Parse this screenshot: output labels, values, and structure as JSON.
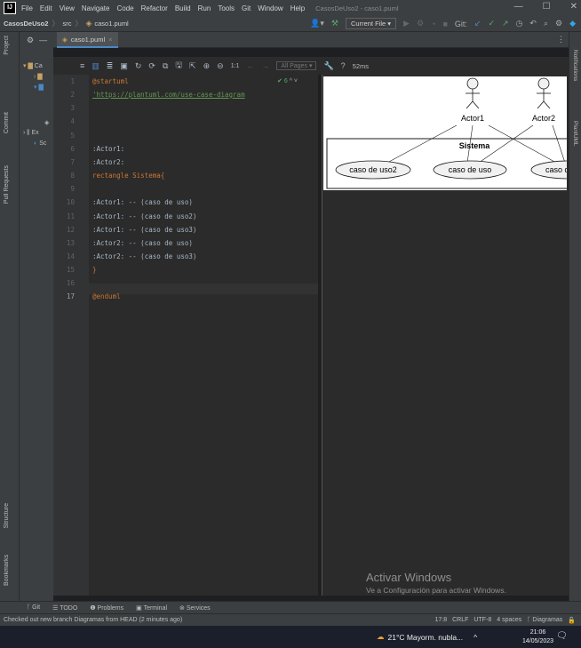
{
  "window": {
    "app_title": "CasosDeUso2 - caso1.puml",
    "menu": [
      "File",
      "Edit",
      "View",
      "Navigate",
      "Code",
      "Refactor",
      "Build",
      "Run",
      "Tools",
      "Git",
      "Window",
      "Help"
    ],
    "controls": {
      "minimize": "—",
      "maximize": "☐",
      "close": "✕"
    }
  },
  "navbar": {
    "project": "CasosDeUso2",
    "folder": "src",
    "file": "caso1.puml",
    "run_config": "Current File ▾",
    "git_label": "Git:"
  },
  "left_tool_tabs": [
    "Project",
    "Commit",
    "Pull Requests",
    "Structure",
    "Bookmarks"
  ],
  "right_tool_tabs": [
    "Notifications",
    "PlantUML"
  ],
  "project_tree": [
    "Ca",
    "Ex",
    "Sc"
  ],
  "editor_tab": {
    "label": "caso1.puml",
    "close": "×"
  },
  "preview_toolbar": {
    "pages": "All Pages ▾",
    "zoom_label": "1:1",
    "help": "?",
    "render_time": "52ms"
  },
  "inspection": {
    "count": "6",
    "arrows": "^ ˅"
  },
  "code": {
    "lines": [
      {
        "num": "1",
        "text": "@startuml"
      },
      {
        "num": "2",
        "text": "'https://plantuml.com/use-case-diagram"
      },
      {
        "num": "3",
        "text": ""
      },
      {
        "num": "4",
        "text": ""
      },
      {
        "num": "5",
        "text": ""
      },
      {
        "num": "6",
        "text": ":Actor1:"
      },
      {
        "num": "7",
        "text": ":Actor2:"
      },
      {
        "num": "8",
        "text": "rectangle Sistema{"
      },
      {
        "num": "9",
        "text": ""
      },
      {
        "num": "10",
        "text": ":Actor1: -- (caso de uso)"
      },
      {
        "num": "11",
        "text": ":Actor1: -- (caso de uso2)"
      },
      {
        "num": "12",
        "text": ":Actor1: -- (caso de uso3)"
      },
      {
        "num": "13",
        "text": ":Actor2: -- (caso de uso)"
      },
      {
        "num": "14",
        "text": ":Actor2: -- (caso de uso3)"
      },
      {
        "num": "15",
        "text": "}"
      },
      {
        "num": "16",
        "text": ""
      },
      {
        "num": "17",
        "text": "@enduml"
      }
    ]
  },
  "diagram": {
    "actors": [
      "Actor1",
      "Actor2"
    ],
    "system_label": "Sistema",
    "use_cases": [
      "caso de uso2",
      "caso de uso",
      "caso d"
    ]
  },
  "watermark": {
    "line1": "Activar Windows",
    "line2": "Ve a Configuración para activar Windows."
  },
  "bottom_tools": [
    "Git",
    "TODO",
    "Problems",
    "Terminal",
    "Services"
  ],
  "status": {
    "message": "Checked out new branch Diagramas from HEAD (2 minutes ago)",
    "position": "17:8",
    "line_sep": "CRLF",
    "encoding": "UTF-8",
    "indent": "4 spaces",
    "branch": "Diagramas"
  },
  "taskbar": {
    "weather": "21°C  Mayorm. nubla...",
    "time": "21:06",
    "date": "14/05/2023"
  }
}
